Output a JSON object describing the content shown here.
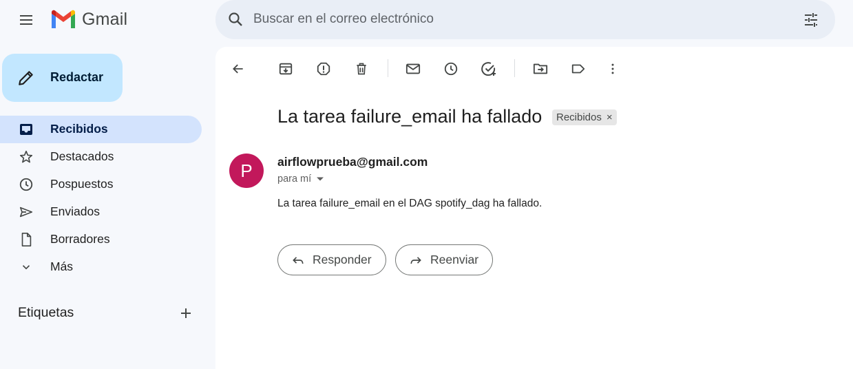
{
  "header": {
    "app_name": "Gmail",
    "search_placeholder": "Buscar en el correo electrónico"
  },
  "sidebar": {
    "compose_label": "Redactar",
    "items": [
      {
        "label": "Recibidos",
        "icon": "inbox-icon",
        "active": true
      },
      {
        "label": "Destacados",
        "icon": "star-icon",
        "active": false
      },
      {
        "label": "Pospuestos",
        "icon": "clock-icon",
        "active": false
      },
      {
        "label": "Enviados",
        "icon": "send-icon",
        "active": false
      },
      {
        "label": "Borradores",
        "icon": "draft-icon",
        "active": false
      },
      {
        "label": "Más",
        "icon": "chevron-down-icon",
        "active": false
      }
    ],
    "labels_heading": "Etiquetas"
  },
  "email": {
    "subject": "La tarea failure_email ha fallado",
    "label_chip": "Recibidos",
    "avatar_letter": "P",
    "avatar_color": "#c2185b",
    "sender": "airflowprueba@gmail.com",
    "to_line": "para mí",
    "body": "La tarea failure_email en el DAG spotify_dag ha fallado.",
    "reply_label": "Responder",
    "forward_label": "Reenviar"
  },
  "colors": {
    "compose_bg": "#c2e7ff",
    "active_nav_bg": "#d3e3fd",
    "search_bg": "#e9eef6",
    "page_bg": "#f6f8fc"
  }
}
